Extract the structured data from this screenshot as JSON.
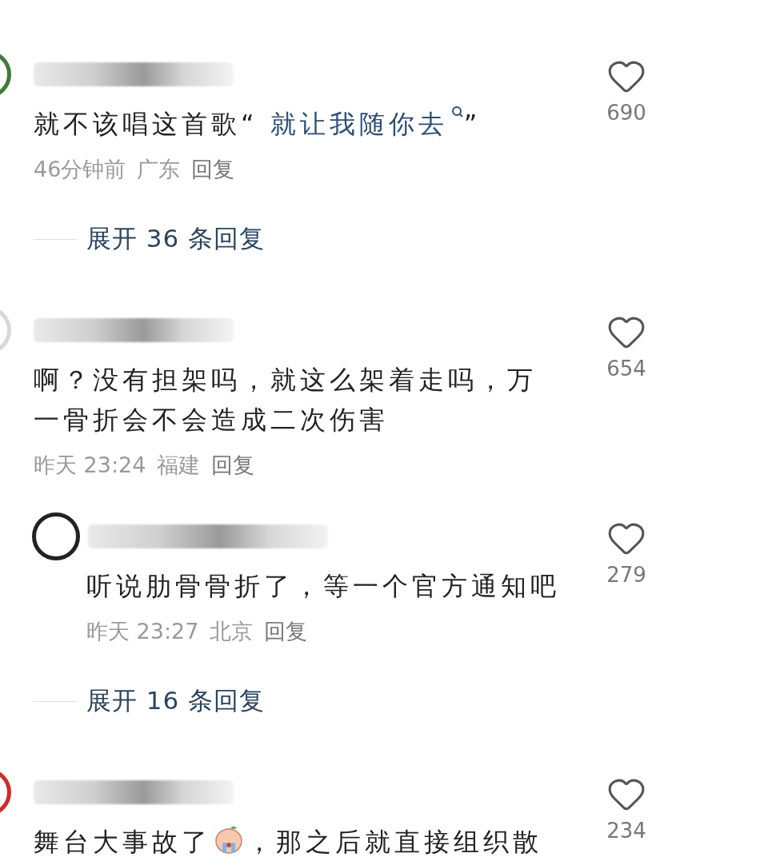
{
  "comments": [
    {
      "kind": "top",
      "color": "#3f7a3a",
      "segments": [
        {
          "kind": "text",
          "text": "就不该唱这首歌“ "
        },
        {
          "kind": "link",
          "text": "就让我随你去"
        },
        {
          "kind": "text",
          "text": "”"
        }
      ],
      "time": "46分钟前",
      "location": "广东",
      "reply": "回复",
      "likes": "690",
      "expand": "展开 36 条回复"
    },
    {
      "kind": "top",
      "color": "#d8d8d8",
      "segments": [
        {
          "kind": "text",
          "text": "啊？没有担架吗，就这么架着走吗，万一骨折会不会造成二次伤害"
        }
      ],
      "time": "昨天 23:24",
      "location": "福建",
      "reply": "回复",
      "likes": "654"
    },
    {
      "kind": "reply",
      "color": "#222222",
      "segments": [
        {
          "kind": "text",
          "text": "听说肋骨骨折了，等一个官方通知吧"
        }
      ],
      "time": "昨天 23:27",
      "location": "北京",
      "reply": "回复",
      "likes": "279",
      "expand": "展开 16 条回复"
    },
    {
      "kind": "top",
      "color": "#d22a2a",
      "segments": [
        {
          "kind": "text",
          "text": "舞台大事故了"
        },
        {
          "kind": "emoji"
        },
        {
          "kind": "text",
          "text": "，那之后就直接组织散"
        }
      ],
      "likes": "234"
    }
  ]
}
